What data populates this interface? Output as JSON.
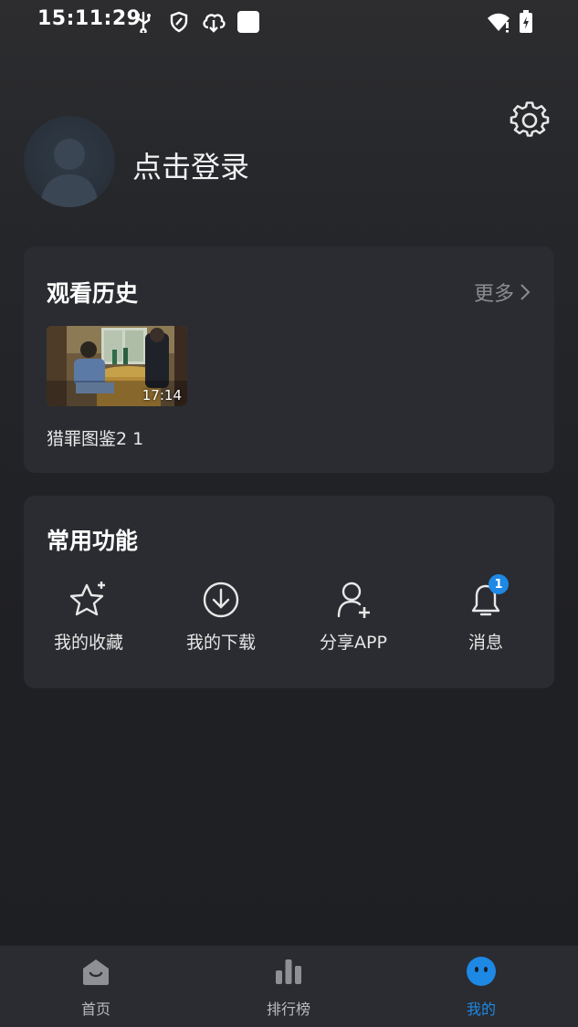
{
  "status_bar": {
    "time": "15:11:29",
    "icons": [
      "usb-icon",
      "shield-icon",
      "cloud-download-icon",
      "square-icon",
      "wifi-icon",
      "battery-icon"
    ]
  },
  "header": {
    "login_prompt": "点击登录",
    "settings_icon": "gear-icon"
  },
  "history": {
    "title": "观看历史",
    "more_label": "更多",
    "items": [
      {
        "title": "猎罪图鉴2 1",
        "duration": "17:14"
      }
    ]
  },
  "functions": {
    "title": "常用功能",
    "items": [
      {
        "label": "我的收藏",
        "icon": "star-icon"
      },
      {
        "label": "我的下载",
        "icon": "download-icon"
      },
      {
        "label": "分享APP",
        "icon": "add-user-icon"
      },
      {
        "label": "消息",
        "icon": "bell-icon",
        "badge": "1"
      }
    ]
  },
  "bottom_nav": {
    "items": [
      {
        "label": "首页",
        "icon": "home-icon",
        "active": false
      },
      {
        "label": "排行榜",
        "icon": "bar-chart-icon",
        "active": false
      },
      {
        "label": "我的",
        "icon": "smile-face-icon",
        "active": true
      }
    ]
  },
  "colors": {
    "accent": "#1e88e5",
    "card_bg": "#2a2c31",
    "muted_text": "#8a8c90"
  }
}
